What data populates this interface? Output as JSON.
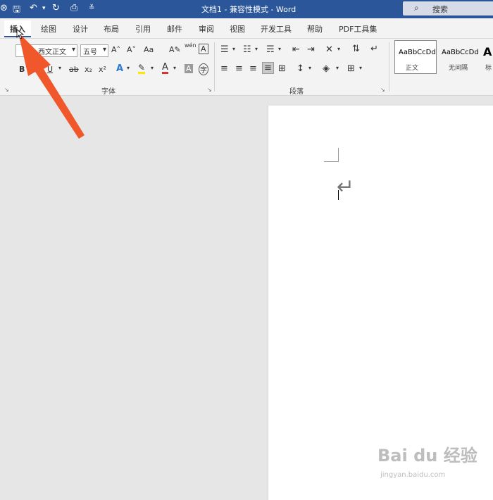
{
  "window": {
    "title": "文档1 - 兼容性模式 - Word",
    "search_placeholder": "搜索"
  },
  "ribbon_tabs": [
    "插入",
    "绘图",
    "设计",
    "布局",
    "引用",
    "邮件",
    "审阅",
    "视图",
    "开发工具",
    "帮助",
    "PDF工具集"
  ],
  "font_group": {
    "label": "字体",
    "font_name": "西文正文",
    "font_size": "五号",
    "grow": "A˄",
    "shrink": "A˅",
    "change_case": "Aa",
    "bold": "B",
    "italic": "I",
    "underline": "U",
    "strikethrough": "ab",
    "subscript": "x₂",
    "superscript": "x²",
    "pinyin": "wén",
    "char_border": "A",
    "shading": "A",
    "enclose": "字"
  },
  "paragraph_group": {
    "label": "段落"
  },
  "styles": [
    {
      "preview": "AaBbCcDd",
      "name": "正文"
    },
    {
      "preview": "AaBbCcDd",
      "name": "无间隔"
    },
    {
      "preview": "A",
      "name": "标"
    }
  ],
  "colors": {
    "title_bar": "#2b579a",
    "arrow": "#f0572a",
    "font_color": "#d13438",
    "highlight": "#ffe600"
  },
  "watermark": {
    "logo": "Bai du 经验",
    "url": "jingyan.baidu.com"
  }
}
